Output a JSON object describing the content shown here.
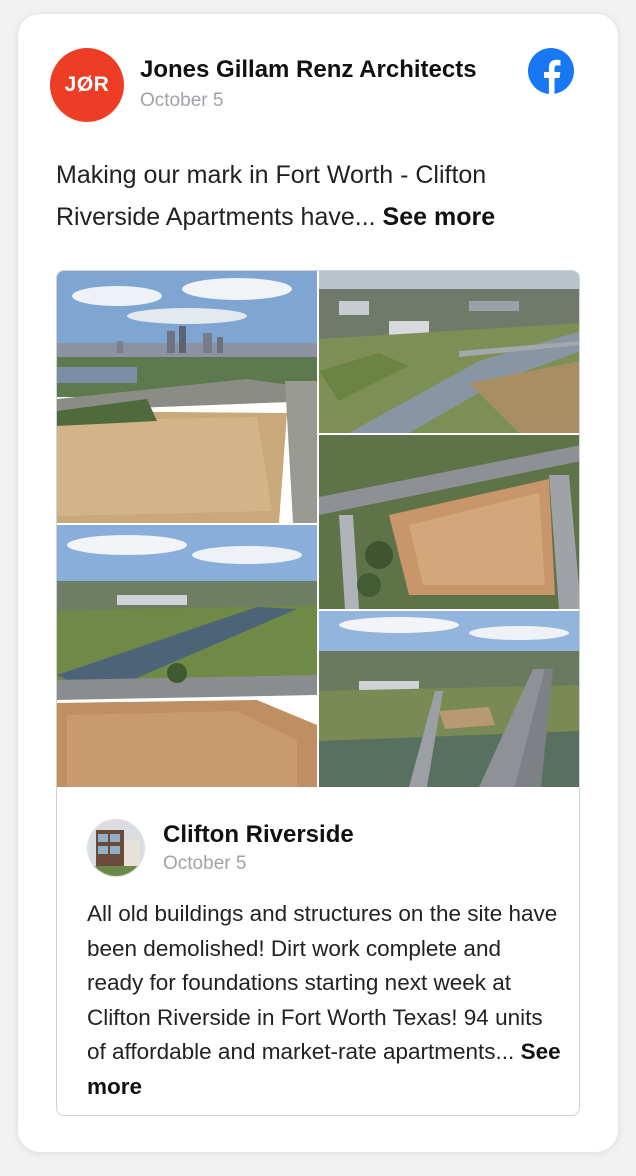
{
  "post": {
    "page_name": "Jones Gillam Renz Architects",
    "logo_text": "JØR",
    "date": "October 5",
    "text": "Making our mark in Fort Worth - Clifton Riverside Apartments have...",
    "see_more": "See more",
    "platform_icon": "facebook-icon",
    "brand_color": "#ee3d25",
    "facebook_color": "#1877f2"
  },
  "shared_post": {
    "name": "Clifton Riverside",
    "date": "October 5",
    "text": "All old buildings and structures on the site have been demolished! Dirt work complete and ready for foundations starting next week at Clifton Riverside in Fort Worth Texas! 94 units of affordable and market-rate apartments...",
    "see_more": "See more",
    "photos": [
      "aerial-skyline-site-photo",
      "aerial-river-overview-photo",
      "aerial-river-site-photo",
      "aerial-cleared-lot-photo",
      "aerial-highway-bridge-photo"
    ]
  }
}
